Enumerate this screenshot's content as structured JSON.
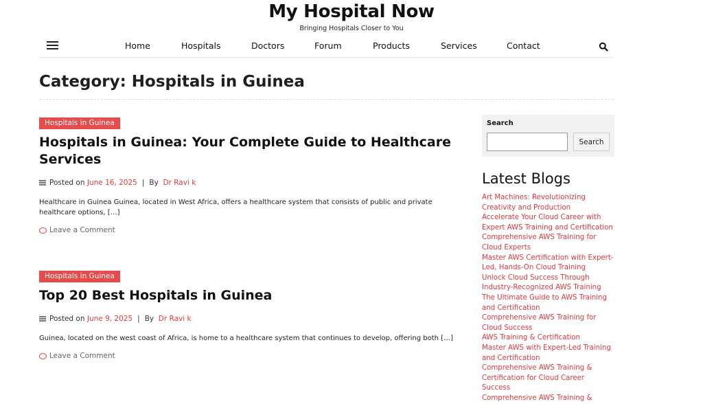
{
  "header": {
    "site_title": "My Hospital Now",
    "tagline": "Bringing Hospitals Closer to You"
  },
  "nav": {
    "items": [
      "Home",
      "Hospitals",
      "Doctors",
      "Forum",
      "Products",
      "Services",
      "Contact"
    ],
    "menu_icon": "hamburger-icon",
    "search_icon": "search-icon"
  },
  "page": {
    "title": "Category: Hospitals in Guinea"
  },
  "posts": [
    {
      "category": "Hospitals in Guinea",
      "title": "Hospitals in Guinea: Your Complete Guide to Healthcare Services",
      "posted_on": "Posted on",
      "date": "June 16, 2025",
      "by": "By",
      "author": "Dr Ravi k",
      "excerpt": "Healthcare in Guinea Guinea, located in West Africa, offers a healthcare system that consists of public and private healthcare options, […]",
      "comment": "Leave a Comment"
    },
    {
      "category": "Hospitals in Guinea",
      "title": "Top 20 Best Hospitals in Guinea",
      "posted_on": "Posted on",
      "date": "June 9, 2025",
      "by": "By",
      "author": "Dr Ravi k",
      "excerpt": "Guinea, located on the west coast of Africa, is home to a healthcare system that continues to develop, offering both […]",
      "comment": "Leave a Comment"
    }
  ],
  "sidebar": {
    "search_label": "Search",
    "search_button": "Search",
    "latest_title": "Latest Blogs",
    "latest": [
      "Art Machines: Revolutionizing Creativity and Production",
      "Accelerate Your Cloud Career with Expert AWS Training and Certification",
      "Comprehensive AWS Training for Cloud Experts",
      "Master AWS Certification with Expert-Led, Hands-On Cloud Training",
      "Unlock Cloud Success Through Industry-Recognized AWS Training",
      "The Ultimate Guide to AWS Training and Certification",
      "Comprehensive AWS Training for Cloud Success",
      "AWS Training & Certification",
      "Master AWS with Expert-Led Training and Certification",
      "Comprehensive AWS Training & Certification for Cloud Career Success",
      "Comprehensive AWS Training &"
    ]
  },
  "colors": {
    "accent": "#e94b4b",
    "link": "#e0383e"
  }
}
